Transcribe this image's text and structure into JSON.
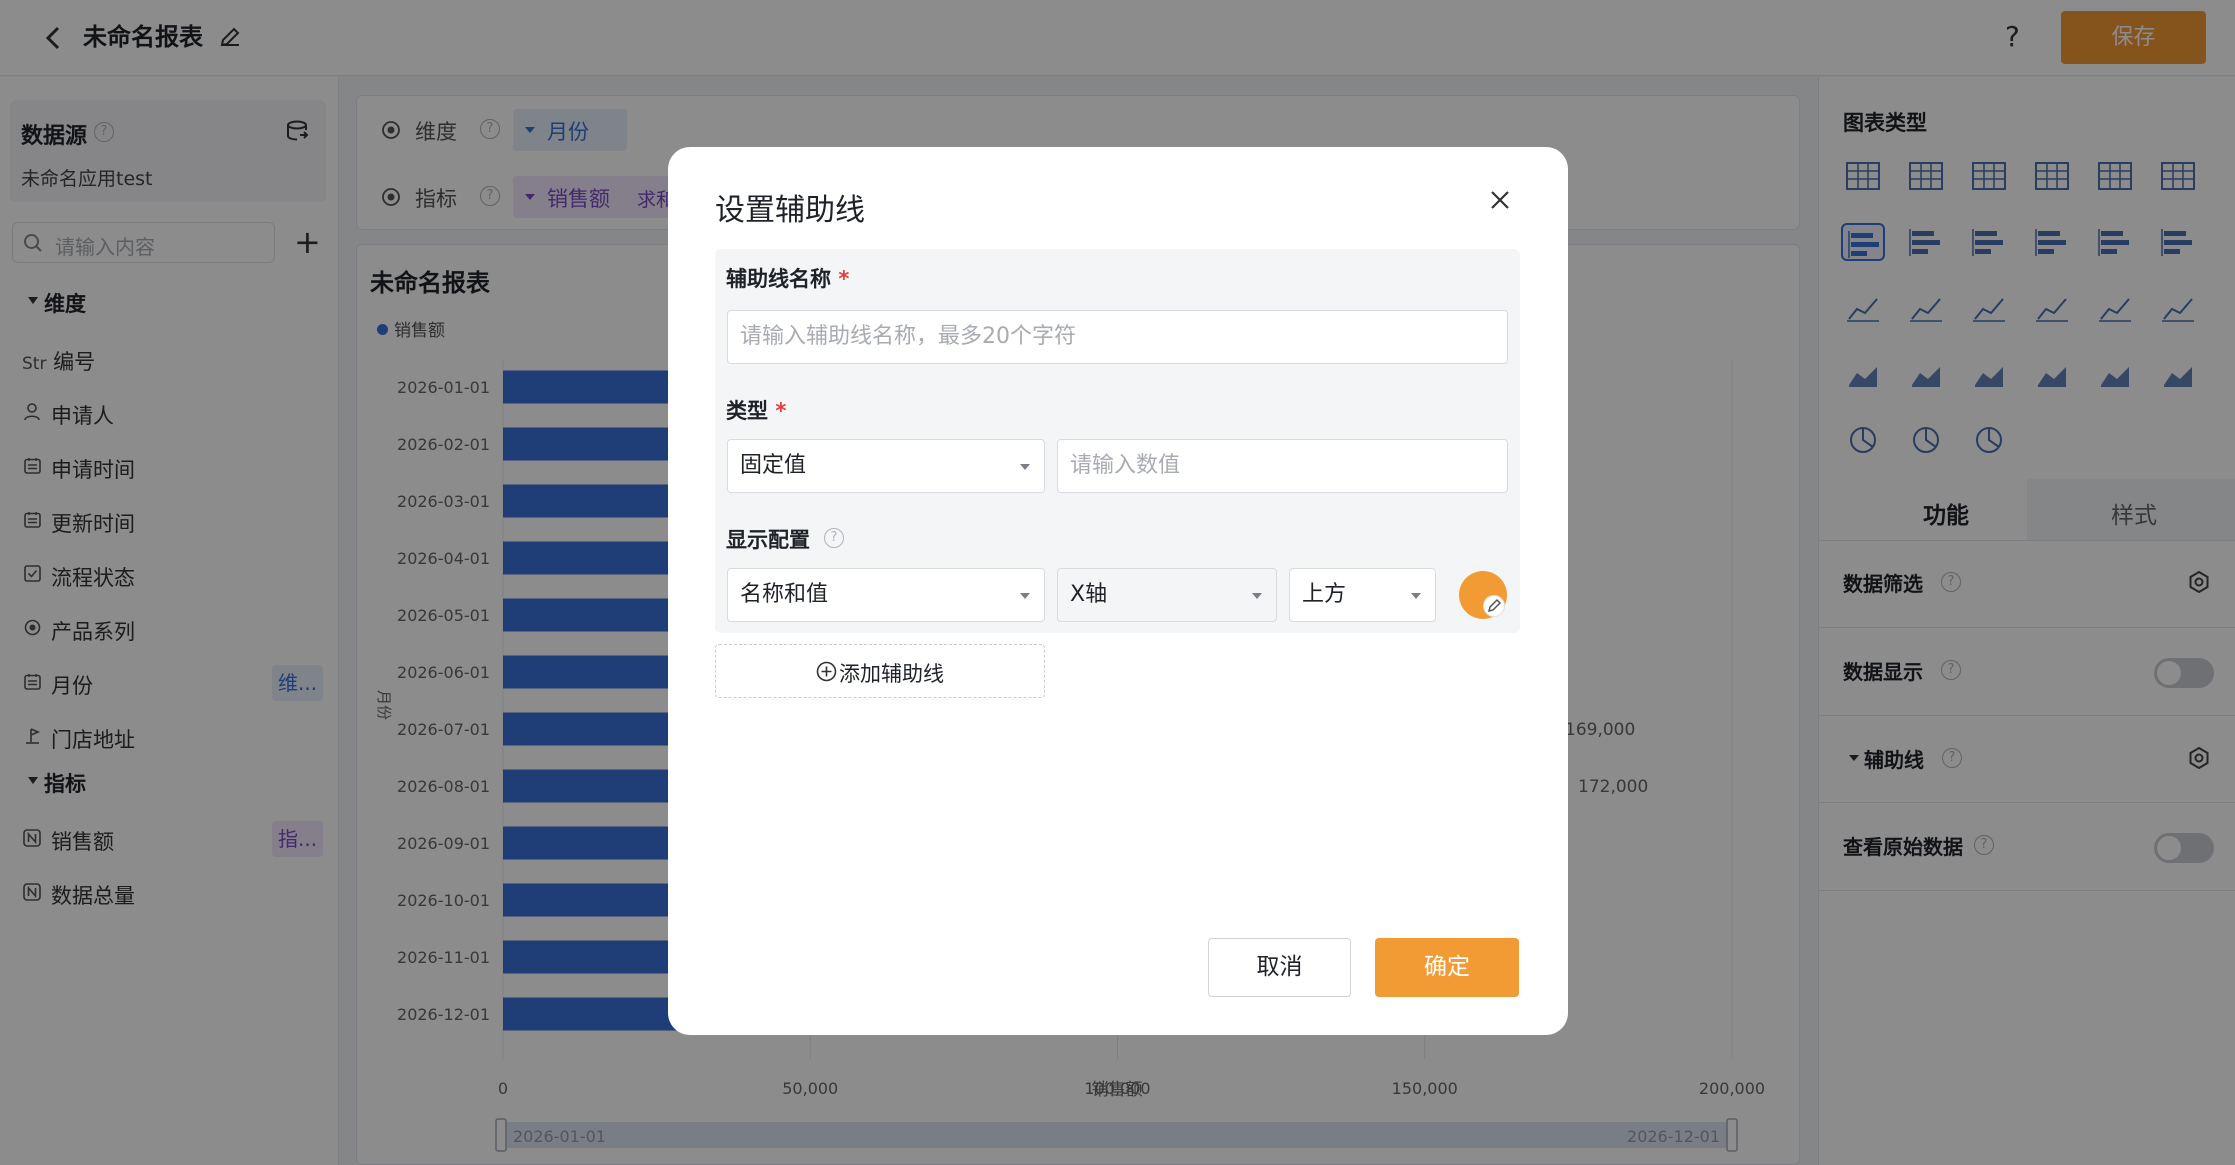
{
  "header": {
    "title": "未命名报表",
    "help": "?",
    "save": "保存"
  },
  "datasource": {
    "title": "数据源",
    "app": "未命名应用test"
  },
  "search": {
    "placeholder": "请输入内容",
    "add": "+"
  },
  "dimensions": {
    "title": "维度",
    "items": [
      {
        "prefix": "Str",
        "label": "编号"
      },
      {
        "label": "申请人",
        "icon": "user-icon"
      },
      {
        "label": "申请时间",
        "icon": "calendar-icon"
      },
      {
        "label": "更新时间",
        "icon": "calendar-icon"
      },
      {
        "label": "流程状态",
        "icon": "checkbox-icon"
      },
      {
        "label": "产品系列",
        "icon": "radio-icon"
      },
      {
        "label": "月份",
        "icon": "calendar-icon",
        "tag": "维..."
      },
      {
        "label": "门店地址",
        "icon": "location-icon"
      }
    ]
  },
  "metrics": {
    "title": "指标",
    "items": [
      {
        "label": "销售额",
        "tag": "指..."
      },
      {
        "label": "数据总量"
      }
    ]
  },
  "fieldbar": {
    "dim_label": "维度",
    "dim_value": "月份",
    "metric_label": "指标",
    "metric_value": "销售额",
    "metric_agg": "求和"
  },
  "chart_data": {
    "type": "bar",
    "title": "未命名报表",
    "legend": "销售额",
    "xlabel": "销售额",
    "ylabel": "月份",
    "categories": [
      "2026-01-01",
      "2026-02-01",
      "2026-03-01",
      "2026-04-01",
      "2026-05-01",
      "2026-06-01",
      "2026-07-01",
      "2026-08-01",
      "2026-09-01",
      "2026-10-01",
      "2026-11-01",
      "2026-12-01"
    ],
    "xlim": [
      0,
      200000
    ],
    "xticks": [
      "0",
      "50,000",
      "100,000",
      "150,000",
      "200,000"
    ],
    "visible_labels": {
      "2026-07-01": "169,000",
      "2026-08-01": "172,000"
    },
    "range_start": "2026-01-01",
    "range_end": "2026-12-01",
    "color": "#3a6fd8"
  },
  "right": {
    "chart_type_title": "图表类型",
    "tab_function": "功能",
    "tab_style": "样式",
    "rows": [
      {
        "label": "数据筛选"
      },
      {
        "label": "数据显示"
      },
      {
        "label": "辅助线"
      },
      {
        "label": "查看原始数据"
      }
    ]
  },
  "modal": {
    "title": "设置辅助线",
    "name_label": "辅助线名称",
    "required": "*",
    "name_placeholder": "请输入辅助线名称，最多20个字符",
    "type_label": "类型",
    "type_value": "固定值",
    "value_placeholder": "请输入数值",
    "display_label": "显示配置",
    "display_value": "名称和值",
    "axis_value": "X轴",
    "position_value": "上方",
    "add_line": "添加辅助线",
    "cancel": "取消",
    "confirm": "确定",
    "accent": "#f29a33"
  }
}
